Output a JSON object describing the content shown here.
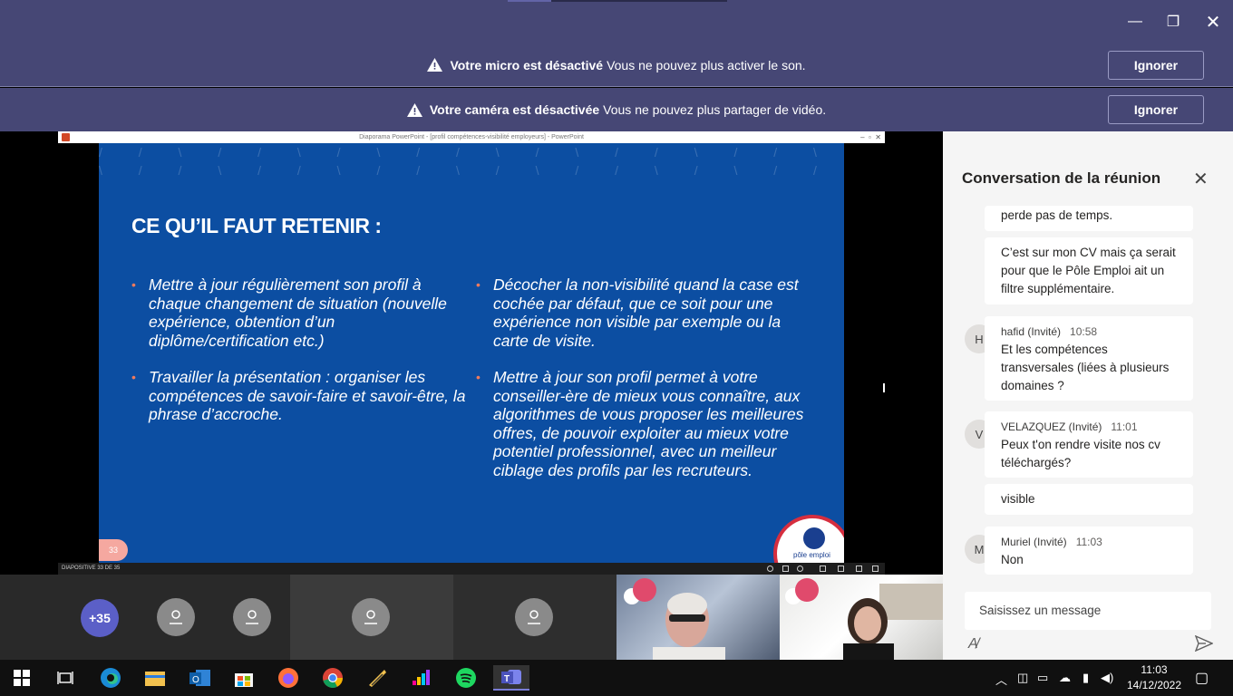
{
  "banners": [
    {
      "bold": "Votre micro est désactivé",
      "text": "Vous ne pouvez plus activer le son.",
      "button": "Ignorer"
    },
    {
      "bold": "Votre caméra est désactivée",
      "text": "Vous ne pouvez plus partager de vidéo.",
      "button": "Ignorer"
    }
  ],
  "ppt": {
    "window_title": "Diaporama PowerPoint - [profil compétences-visibilité employeurs] - PowerPoint",
    "footer": "DIAPOSITIVE 33 DE 35",
    "slide": {
      "title": "CE QU’IL FAUT RETENIR :",
      "left": [
        "Mettre à jour régulièrement son profil à chaque changement de situation (nouvelle expérience, obtention d’un diplôme/certification etc.)",
        "Travailler la présentation : organiser les compétences de savoir-faire et savoir-être, la phrase d’accroche."
      ],
      "right": [
        "Décocher la non-visibilité quand la case est cochée par défaut, que ce soit pour une expérience non visible par exemple ou la carte de visite.",
        "Mettre à jour son profil permet à votre conseiller-ère de mieux vous connaître, aux algorithmes de vous proposer les meilleures offres, de pouvoir exploiter au mieux votre potentiel professionnel, avec un meilleur ciblage des profils par les recruteurs."
      ],
      "number": "33",
      "logo_text": "pôle emploi"
    }
  },
  "participants": {
    "more": "+35"
  },
  "chat": {
    "title": "Conversation de la réunion",
    "messages": [
      {
        "text": "perde pas de temps."
      },
      {
        "text": "C’est sur mon CV mais ça serait pour que le Pôle Emploi ait un filtre supplémentaire."
      },
      {
        "initial": "H",
        "author": "hafid (Invité)",
        "time": "10:58",
        "text": "Et les compétences transversales (liées à plusieurs domaines ?"
      },
      {
        "initial": "V",
        "author": "VELAZQUEZ (Invité)",
        "time": "11:01",
        "text": "Peux t'on rendre visite nos cv téléchargés?"
      },
      {
        "text": "visible"
      },
      {
        "initial": "M",
        "author": "Muriel (Invité)",
        "time": "11:03",
        "text": "Non"
      }
    ],
    "input_placeholder": "Saisissez un message"
  },
  "taskbar": {
    "time": "11:03",
    "date": "14/12/2022"
  }
}
